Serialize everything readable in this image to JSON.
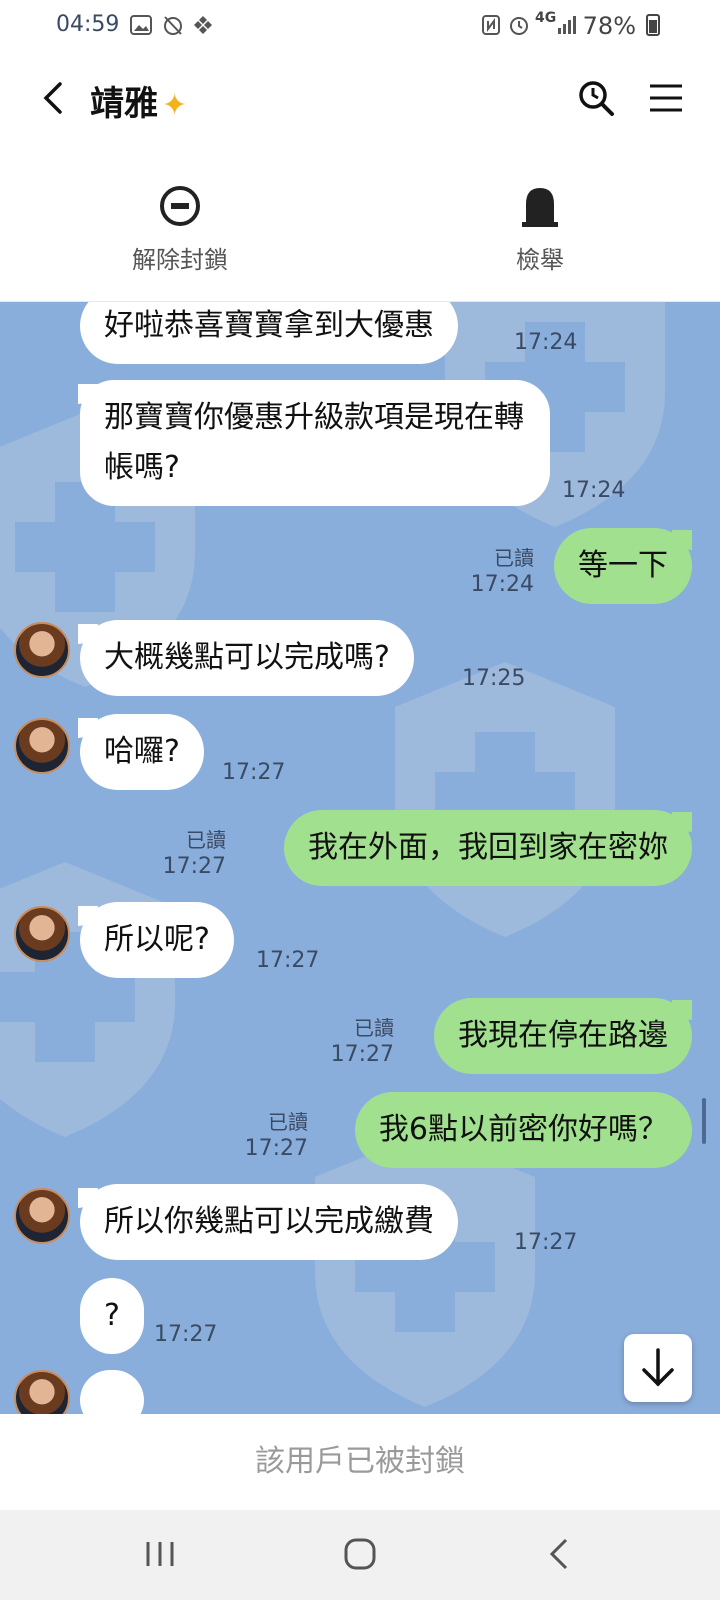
{
  "status_bar": {
    "time": "04:59",
    "network": "4G",
    "battery": "78%"
  },
  "header": {
    "contact_name": "靖雅"
  },
  "actions": {
    "unblock_label": "解除封鎖",
    "report_label": "檢舉"
  },
  "messages": [
    {
      "side": "in",
      "text": "好啦恭喜寶寶拿到大優惠",
      "time": "17:24"
    },
    {
      "side": "in",
      "text": "那寶寶你優惠升級款項是現在轉帳嗎?",
      "time": "17:24"
    },
    {
      "side": "out",
      "text": "等一下",
      "time": "17:24",
      "read": "已讀"
    },
    {
      "side": "in",
      "text": "大概幾點可以完成嗎?",
      "time": "17:25"
    },
    {
      "side": "in",
      "text": "哈囉?",
      "time": "17:27"
    },
    {
      "side": "out",
      "text": "我在外面，我回到家在密妳",
      "time": "17:27",
      "read": "已讀"
    },
    {
      "side": "in",
      "text": "所以呢?",
      "time": "17:27"
    },
    {
      "side": "out",
      "text": "我現在停在路邊",
      "time": "17:27",
      "read": "已讀"
    },
    {
      "side": "out",
      "text": "我6點以前密你好嗎？",
      "time": "17:27",
      "read": "已讀"
    },
    {
      "side": "in",
      "text": "所以你幾點可以完成繳費",
      "time": "17:27"
    },
    {
      "side": "in",
      "text": "?",
      "time": "17:27"
    }
  ],
  "footer": {
    "blocked_text": "該用戶已被封鎖"
  },
  "icons": {
    "back": "chevron-left-icon",
    "search": "search-clock-icon",
    "menu": "hamburger-menu-icon",
    "unblock": "minus-circle-icon",
    "report": "tombstone-report-icon",
    "scroll_down": "arrow-down-icon"
  },
  "colors": {
    "chat_bg": "#8aaedc",
    "outgoing_bubble": "#a1e08f",
    "incoming_bubble": "#ffffff"
  }
}
